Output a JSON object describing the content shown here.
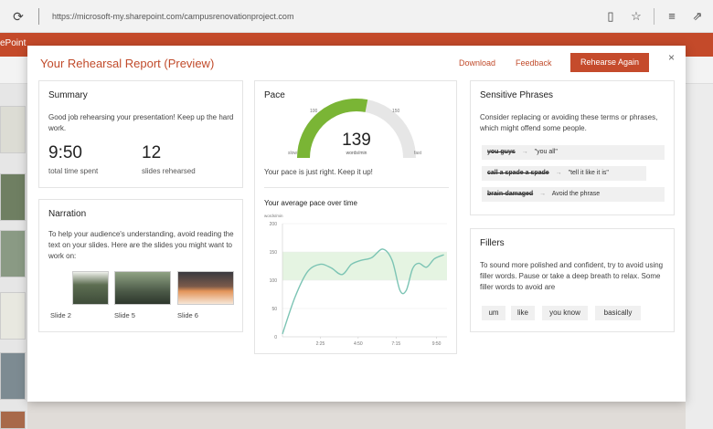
{
  "browser": {
    "url": "https://microsoft-my.sharepoint.com/campusrenovationproject.com"
  },
  "ppt": {
    "brand": "ePoint"
  },
  "dialog": {
    "title": "Your Rehearsal Report (Preview)",
    "download_label": "Download",
    "feedback_label": "Feedback",
    "rehearse_again_label": "Rehearse Again",
    "close_symbol": "×"
  },
  "summary": {
    "title": "Summary",
    "text": "Good job rehearsing your presentation! Keep up the hard work.",
    "time_value": "9:50",
    "time_caption": "total time spent",
    "slides_value": "12",
    "slides_caption": "slides rehearsed"
  },
  "narration": {
    "title": "Narration",
    "text": "To help your audience's understanding, avoid reading the text on your slides. Here are the slides you might want to work on:",
    "slides": [
      {
        "label": "Slide 2"
      },
      {
        "label": "Slide 5"
      },
      {
        "label": "Slide 6"
      }
    ]
  },
  "pace": {
    "title": "Pace",
    "gauge_value": "139",
    "gauge_unit": "words/min",
    "gauge_fraction": 0.56,
    "tick_100": "100",
    "tick_150": "150",
    "label_slow": "slow",
    "label_fast": "fast",
    "message": "Your pace is just right. Keep it up!",
    "chart_title": "Your average pace over time"
  },
  "chart_data": {
    "type": "line",
    "title": "Your average pace over time",
    "ylabel": "words/min",
    "xlabel": "",
    "ylim": [
      0,
      200
    ],
    "xlim": [
      0,
      10.5
    ],
    "y_ticks": [
      "200",
      "150",
      "100",
      "50",
      "0"
    ],
    "x_ticks": [
      "2:25",
      "4:50",
      "7:15",
      "9:50"
    ],
    "x_tick_values": [
      2.417,
      4.833,
      7.25,
      9.833
    ],
    "band": [
      100,
      150
    ],
    "series": [
      {
        "values_x": [
          0,
          0.8,
          1.6,
          2.4,
          3.1,
          3.8,
          4.4,
          5.0,
          5.7,
          6.4,
          7.0,
          7.5,
          7.9,
          8.3,
          8.7,
          9.2,
          9.7,
          10.3
        ],
        "values_y": [
          5,
          70,
          115,
          128,
          122,
          110,
          128,
          135,
          140,
          155,
          135,
          82,
          82,
          120,
          130,
          123,
          138,
          145
        ]
      }
    ],
    "accent": "#7cc4b4"
  },
  "sensitive": {
    "title": "Sensitive Phrases",
    "text": "Consider replacing or avoiding these terms or phrases, which might offend some people.",
    "phrases": [
      {
        "term": "you guys",
        "replacement": "\"you all\""
      },
      {
        "term": "call a spade a spade",
        "replacement": "\"tell it like it is\""
      },
      {
        "term": "brain-damaged",
        "replacement": "Avoid the phrase"
      }
    ]
  },
  "fillers": {
    "title": "Fillers",
    "text": "To sound more polished and confident, try to avoid using filler words. Pause or take a deep breath to relax. Some filler words to avoid are",
    "words": [
      "um",
      "like",
      "you know",
      "basically"
    ]
  },
  "colors": {
    "accent": "#c54b2c",
    "gauge_green": "#7ab535",
    "gauge_track": "#e6e6e6"
  }
}
